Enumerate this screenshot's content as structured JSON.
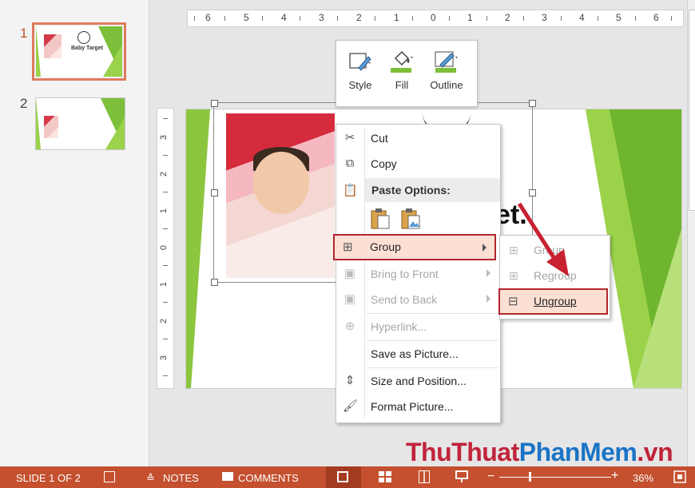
{
  "thumbnails": [
    {
      "number": "1",
      "logo_text": "Baby Target",
      "selected": true
    },
    {
      "number": "2",
      "selected": false
    }
  ],
  "ruler": {
    "horizontal": [
      "6",
      "5",
      "4",
      "3",
      "2",
      "1",
      "0",
      "1",
      "2",
      "3",
      "4",
      "5",
      "6"
    ],
    "vertical": [
      "3",
      "2",
      "1",
      "0",
      "1",
      "2",
      "3"
    ]
  },
  "slide": {
    "text": "et."
  },
  "mini_toolbar": {
    "style_label": "Style",
    "fill_label": "Fill",
    "outline_label": "Outline"
  },
  "context_menu": {
    "cut": "Cut",
    "copy": "Copy",
    "paste_options": "Paste Options:",
    "group": "Group",
    "bring_to_front": "Bring to Front",
    "send_to_back": "Send to Back",
    "hyperlink": "Hyperlink...",
    "save_as_picture": "Save as Picture...",
    "size_and_position": "Size and Position...",
    "format_picture": "Format Picture..."
  },
  "group_submenu": {
    "group": "Group",
    "regroup": "Regroup",
    "ungroup": "Ungroup"
  },
  "watermark": {
    "part1": "ThuThuat",
    "part2": "PhanMem",
    "part3": ".vn"
  },
  "status_bar": {
    "slide_info": "SLIDE 1 OF 2",
    "notes": "NOTES",
    "comments": "COMMENTS",
    "zoom": "36%"
  },
  "colors": {
    "status_bar": "#c4502f",
    "slide_green": "#7cbf3a",
    "highlight_border": "#b3262e",
    "highlight_fill": "#fde0d4",
    "thumb_selected_border": "#e07a5f"
  }
}
